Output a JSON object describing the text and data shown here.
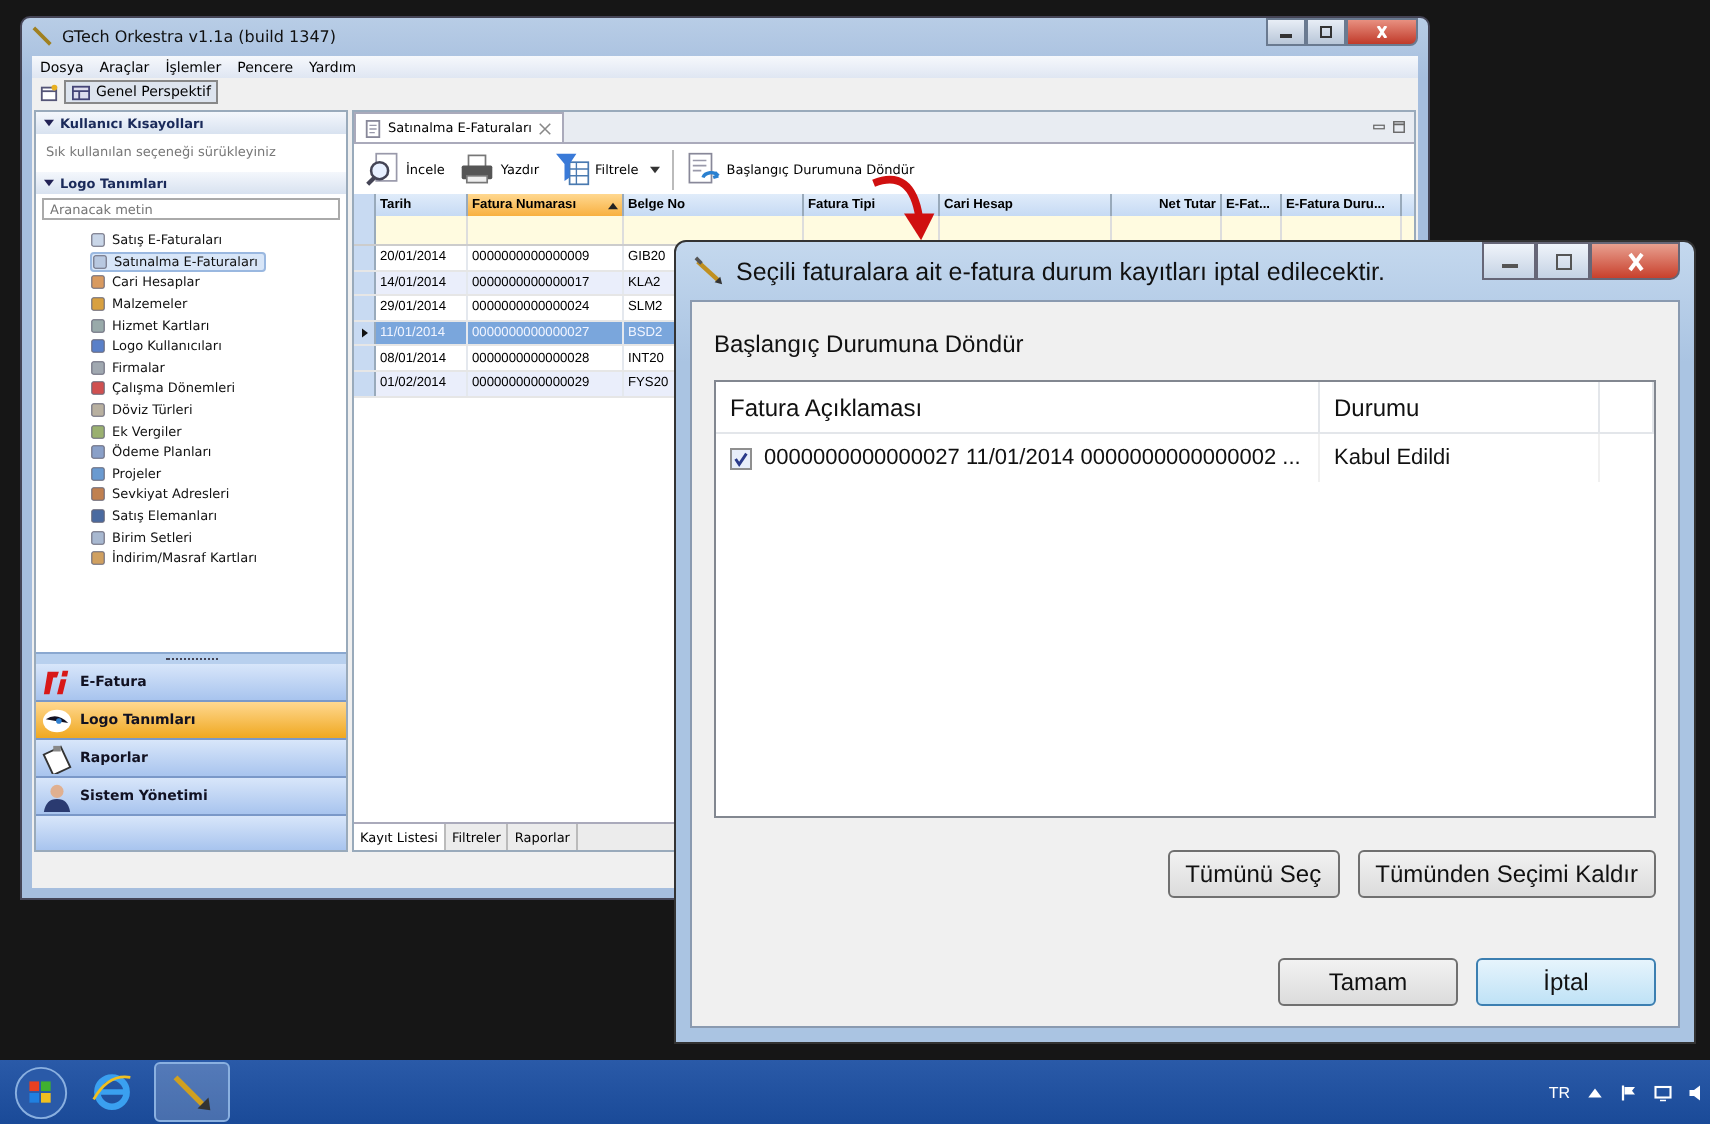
{
  "main_window": {
    "title": "GTech Orkestra v1.1a (build 1347)"
  },
  "menu": [
    "Dosya",
    "Araçlar",
    "İşlemler",
    "Pencere",
    "Yardım"
  ],
  "perspective": {
    "label": "Genel Perspektif",
    "selected": true
  },
  "sidebar": {
    "shortcuts": {
      "title": "Kullanıcı Kısayolları",
      "expanded": true,
      "hint": "Sık kullanılan seçeneği sürükleyiniz"
    },
    "definitions": {
      "title": "Logo Tanımları",
      "expanded": true,
      "search": {
        "placeholder": "Aranacak metin"
      },
      "items": [
        {
          "label": "Satış E-Faturaları",
          "selected": false
        },
        {
          "label": "Satınalma E-Faturaları",
          "selected": true
        },
        {
          "label": "Cari Hesaplar",
          "selected": false
        },
        {
          "label": "Malzemeler",
          "selected": false
        },
        {
          "label": "Hizmet Kartları",
          "selected": false
        },
        {
          "label": "Logo Kullanıcıları",
          "selected": false
        },
        {
          "label": "Firmalar",
          "selected": false
        },
        {
          "label": "Çalışma Dönemleri",
          "selected": false
        },
        {
          "label": "Döviz Türleri",
          "selected": false
        },
        {
          "label": "Ek Vergiler",
          "selected": false
        },
        {
          "label": "Ödeme Planları",
          "selected": false
        },
        {
          "label": "Projeler",
          "selected": false
        },
        {
          "label": "Sevkiyat Adresleri",
          "selected": false
        },
        {
          "label": "Satış Elemanları",
          "selected": false
        },
        {
          "label": "Birim Setleri",
          "selected": false
        },
        {
          "label": "İndirim/Masraf Kartları",
          "selected": false
        }
      ]
    },
    "nav": [
      {
        "label": "E-Fatura",
        "kind": "efatura",
        "selected": false
      },
      {
        "label": "Logo Tanımları",
        "kind": "eye",
        "selected": true
      },
      {
        "label": "Raporlar",
        "kind": "clipboard",
        "selected": false
      },
      {
        "label": "Sistem Yönetimi",
        "kind": "person",
        "selected": false
      }
    ]
  },
  "editor": {
    "tab": "Satınalma E-Faturaları",
    "toolbar": [
      {
        "label": "İncele",
        "kind": "magnifier",
        "dropdown": false
      },
      {
        "label": "Yazdır",
        "kind": "printer",
        "dropdown": false
      },
      {
        "label": "Filtrele",
        "kind": "funnel",
        "dropdown": true
      },
      {
        "label": "Başlangıç Durumuna Döndür",
        "kind": "document",
        "dropdown": false
      }
    ],
    "columns": [
      {
        "label": "Tarih",
        "sorted": false
      },
      {
        "label": "Fatura Numarası",
        "sorted": true
      },
      {
        "label": "Belge No",
        "sorted": false
      },
      {
        "label": "Fatura Tipi",
        "sorted": false
      },
      {
        "label": "Cari Hesap",
        "sorted": false
      },
      {
        "label": "Net Tutar",
        "sorted": false
      },
      {
        "label": "E-Fat...",
        "sorted": false
      },
      {
        "label": "E-Fatura Duru...",
        "sorted": false
      }
    ],
    "rows": [
      {
        "date": "20/01/2014",
        "number": "0000000000000009",
        "doc": "GIB20",
        "selected": false
      },
      {
        "date": "14/01/2014",
        "number": "0000000000000017",
        "doc": "KLA2",
        "selected": false
      },
      {
        "date": "29/01/2014",
        "number": "0000000000000024",
        "doc": "SLM2",
        "selected": false
      },
      {
        "date": "11/01/2014",
        "number": "0000000000000027",
        "doc": "BSD2",
        "selected": true
      },
      {
        "date": "08/01/2014",
        "number": "0000000000000028",
        "doc": "INT20",
        "selected": false
      },
      {
        "date": "01/02/2014",
        "number": "0000000000000029",
        "doc": "FYS20",
        "selected": false
      }
    ],
    "bottom_tabs": [
      {
        "label": "Kayıt Listesi",
        "selected": true
      },
      {
        "label": "Filtreler",
        "selected": false
      },
      {
        "label": "Raporlar",
        "selected": false
      }
    ]
  },
  "dialog": {
    "title": "Seçili faturalara ait e-fatura durum kayıtları iptal edilecektir.",
    "heading": "Başlangıç Durumuna Döndür",
    "columns": [
      "Fatura Açıklaması",
      "Durumu"
    ],
    "rows": [
      {
        "checked": true,
        "description": "0000000000000027 11/01/2014 0000000000000002 ...",
        "status": "Kabul Edildi"
      }
    ],
    "select_buttons": [
      "Tümünü Seç",
      "Tümünden Seçimi Kaldır"
    ],
    "buttons": [
      {
        "label": "Tamam",
        "default": false
      },
      {
        "label": "İptal",
        "default": true
      }
    ]
  },
  "taskbar": {
    "language": "TR"
  }
}
